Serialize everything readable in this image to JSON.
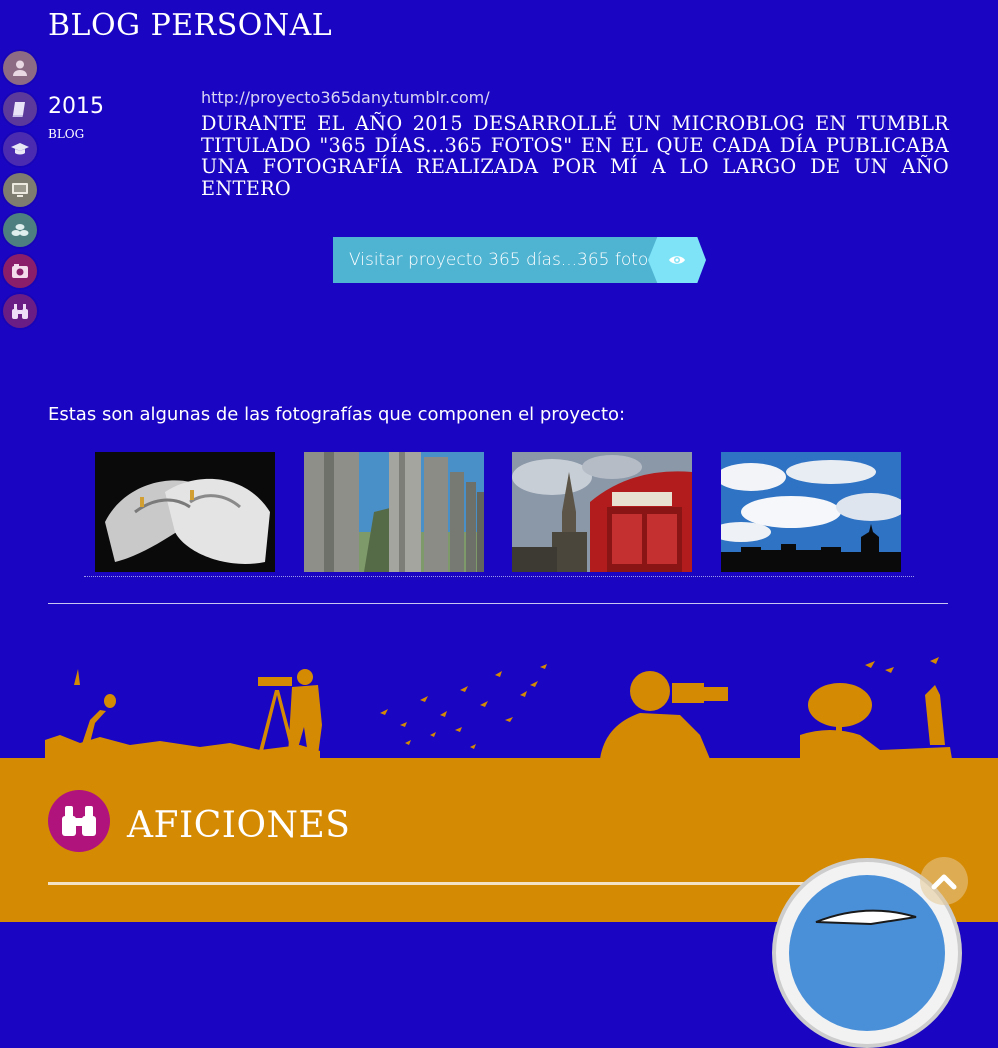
{
  "section": {
    "title": "BLOG PERSONAL"
  },
  "sidenav": {
    "items": [
      {
        "icon": "user-icon",
        "color": "#8d6b84"
      },
      {
        "icon": "book-icon",
        "color": "#5c3a9c"
      },
      {
        "icon": "graduation-cap-icon",
        "color": "#4b2cb0"
      },
      {
        "icon": "monitor-icon",
        "color": "#7e7b70"
      },
      {
        "icon": "stack-icon",
        "color": "#4e7f80"
      },
      {
        "icon": "camera-icon",
        "color": "#8b1e6a"
      },
      {
        "icon": "binoculars-icon",
        "color": "#6b1d86"
      }
    ]
  },
  "entry": {
    "year": "2015",
    "category": "BLOG",
    "url": "http://proyecto365dany.tumblr.com/",
    "description": "Durante el año 2015 desarrollé un microblog en Tumblr titulado \"365 días...365 fotos\" en el que cada día publicaba una fotografía realizada por mí a lo largo de un año entero",
    "button_label": "Visitar proyecto 365 días...365 fotos"
  },
  "photos": {
    "intro": "Estas son algunas de las fotografías que componen el proyecto:",
    "items": [
      "hands-with-rings-photo",
      "stone-columns-photo",
      "red-phone-box-photo",
      "cloudy-sky-photo"
    ]
  },
  "hobbies": {
    "title": "AFICIONES"
  },
  "colors": {
    "background": "#1a05c2",
    "accent_orange": "#d58a04",
    "button": "#4fb3d2",
    "button_arrow": "#7ee3f7"
  }
}
